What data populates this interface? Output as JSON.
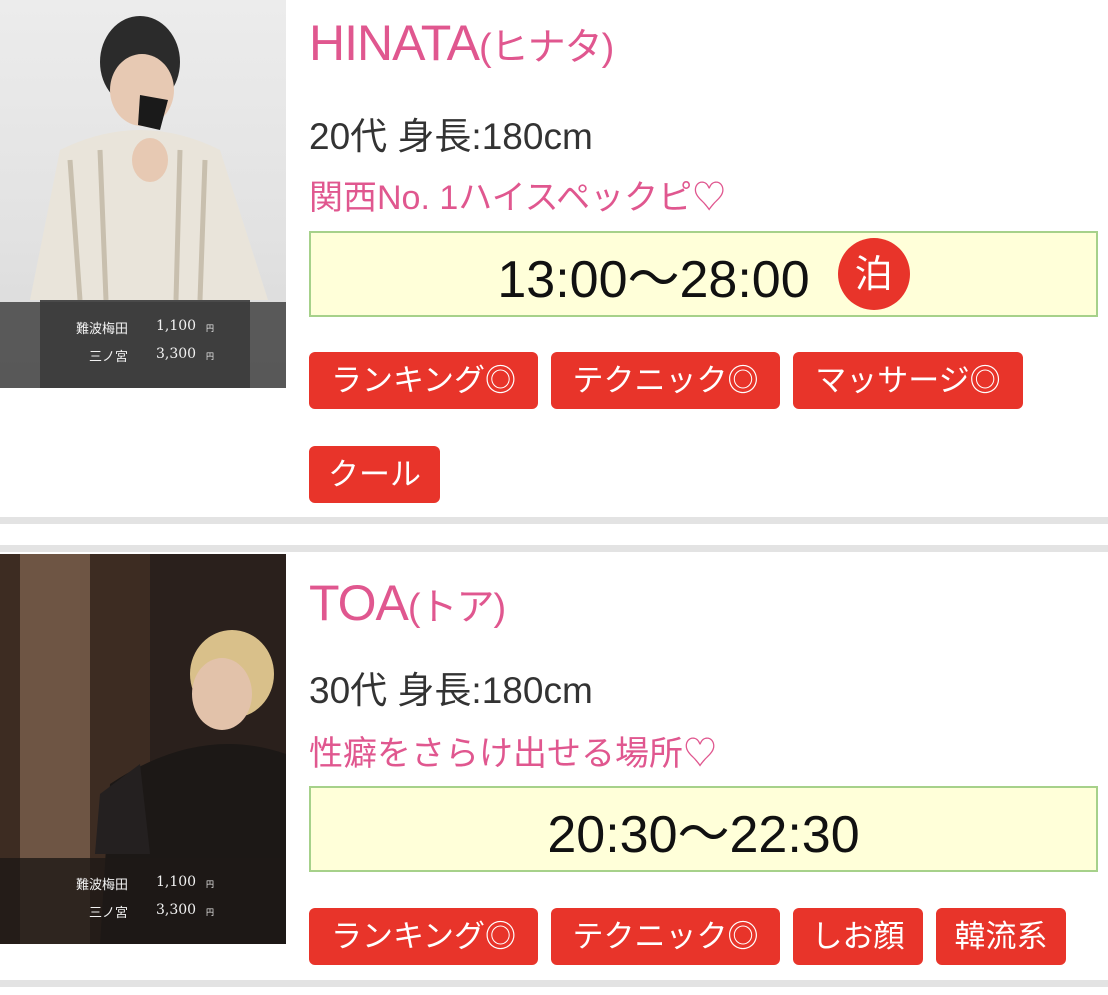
{
  "cast": [
    {
      "name": "HINATA",
      "kana": "(ヒナタ)",
      "age_height": "20代 身長:180cm",
      "catch_copy": "関西No. 1ハイスペックピ♡",
      "hours": "13:00〜28:00",
      "stay_badge": "泊",
      "prices": [
        {
          "area": "難波梅田",
          "amount": "1,100",
          "unit": "円"
        },
        {
          "area": "三ノ宮",
          "amount": "3,300",
          "unit": "円"
        }
      ],
      "tags": [
        "ランキング◎",
        "テクニック◎",
        "マッサージ◎",
        "クール"
      ]
    },
    {
      "name": "TOA",
      "kana": "(トア)",
      "age_height": "30代 身長:180cm",
      "catch_copy": "性癖をさらけ出せる場所♡",
      "hours": "20:30〜22:30",
      "prices": [
        {
          "area": "難波梅田",
          "amount": "1,100",
          "unit": "円"
        },
        {
          "area": "三ノ宮",
          "amount": "3,300",
          "unit": "円"
        }
      ],
      "tags": [
        "ランキング◎",
        "テクニック◎",
        "しお顔",
        "韓流系"
      ]
    }
  ],
  "colors": {
    "name_pink": "#e0578f",
    "tag_red": "#e8342a",
    "hours_bg": "#ffffd9",
    "hours_border": "#a6d18a"
  }
}
